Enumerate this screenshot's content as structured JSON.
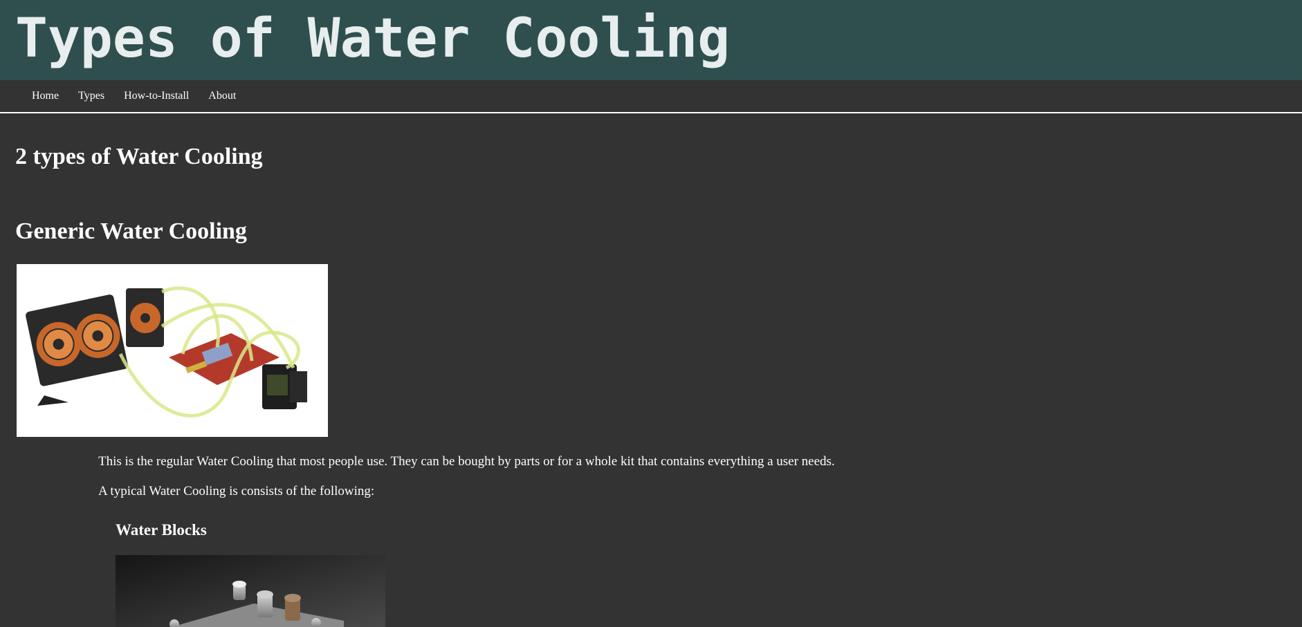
{
  "header": {
    "title": "Types of Water Cooling"
  },
  "nav": {
    "items": [
      {
        "label": "Home"
      },
      {
        "label": "Types"
      },
      {
        "label": "How-to-Install"
      },
      {
        "label": "About"
      }
    ]
  },
  "main": {
    "heading": "2 types of Water Cooling",
    "section_heading": "Generic Water Cooling",
    "paragraph1": "This is the regular Water Cooling that most people use. They can be bought by parts or for a whole kit that contains everything a user needs.",
    "paragraph2": "A typical Water Cooling is consists of the following:",
    "subsection_heading": "Water Blocks"
  },
  "colors": {
    "background": "#333333",
    "banner": "#2f4f4f",
    "title_text": "#e8edee",
    "text": "#ffffff"
  }
}
